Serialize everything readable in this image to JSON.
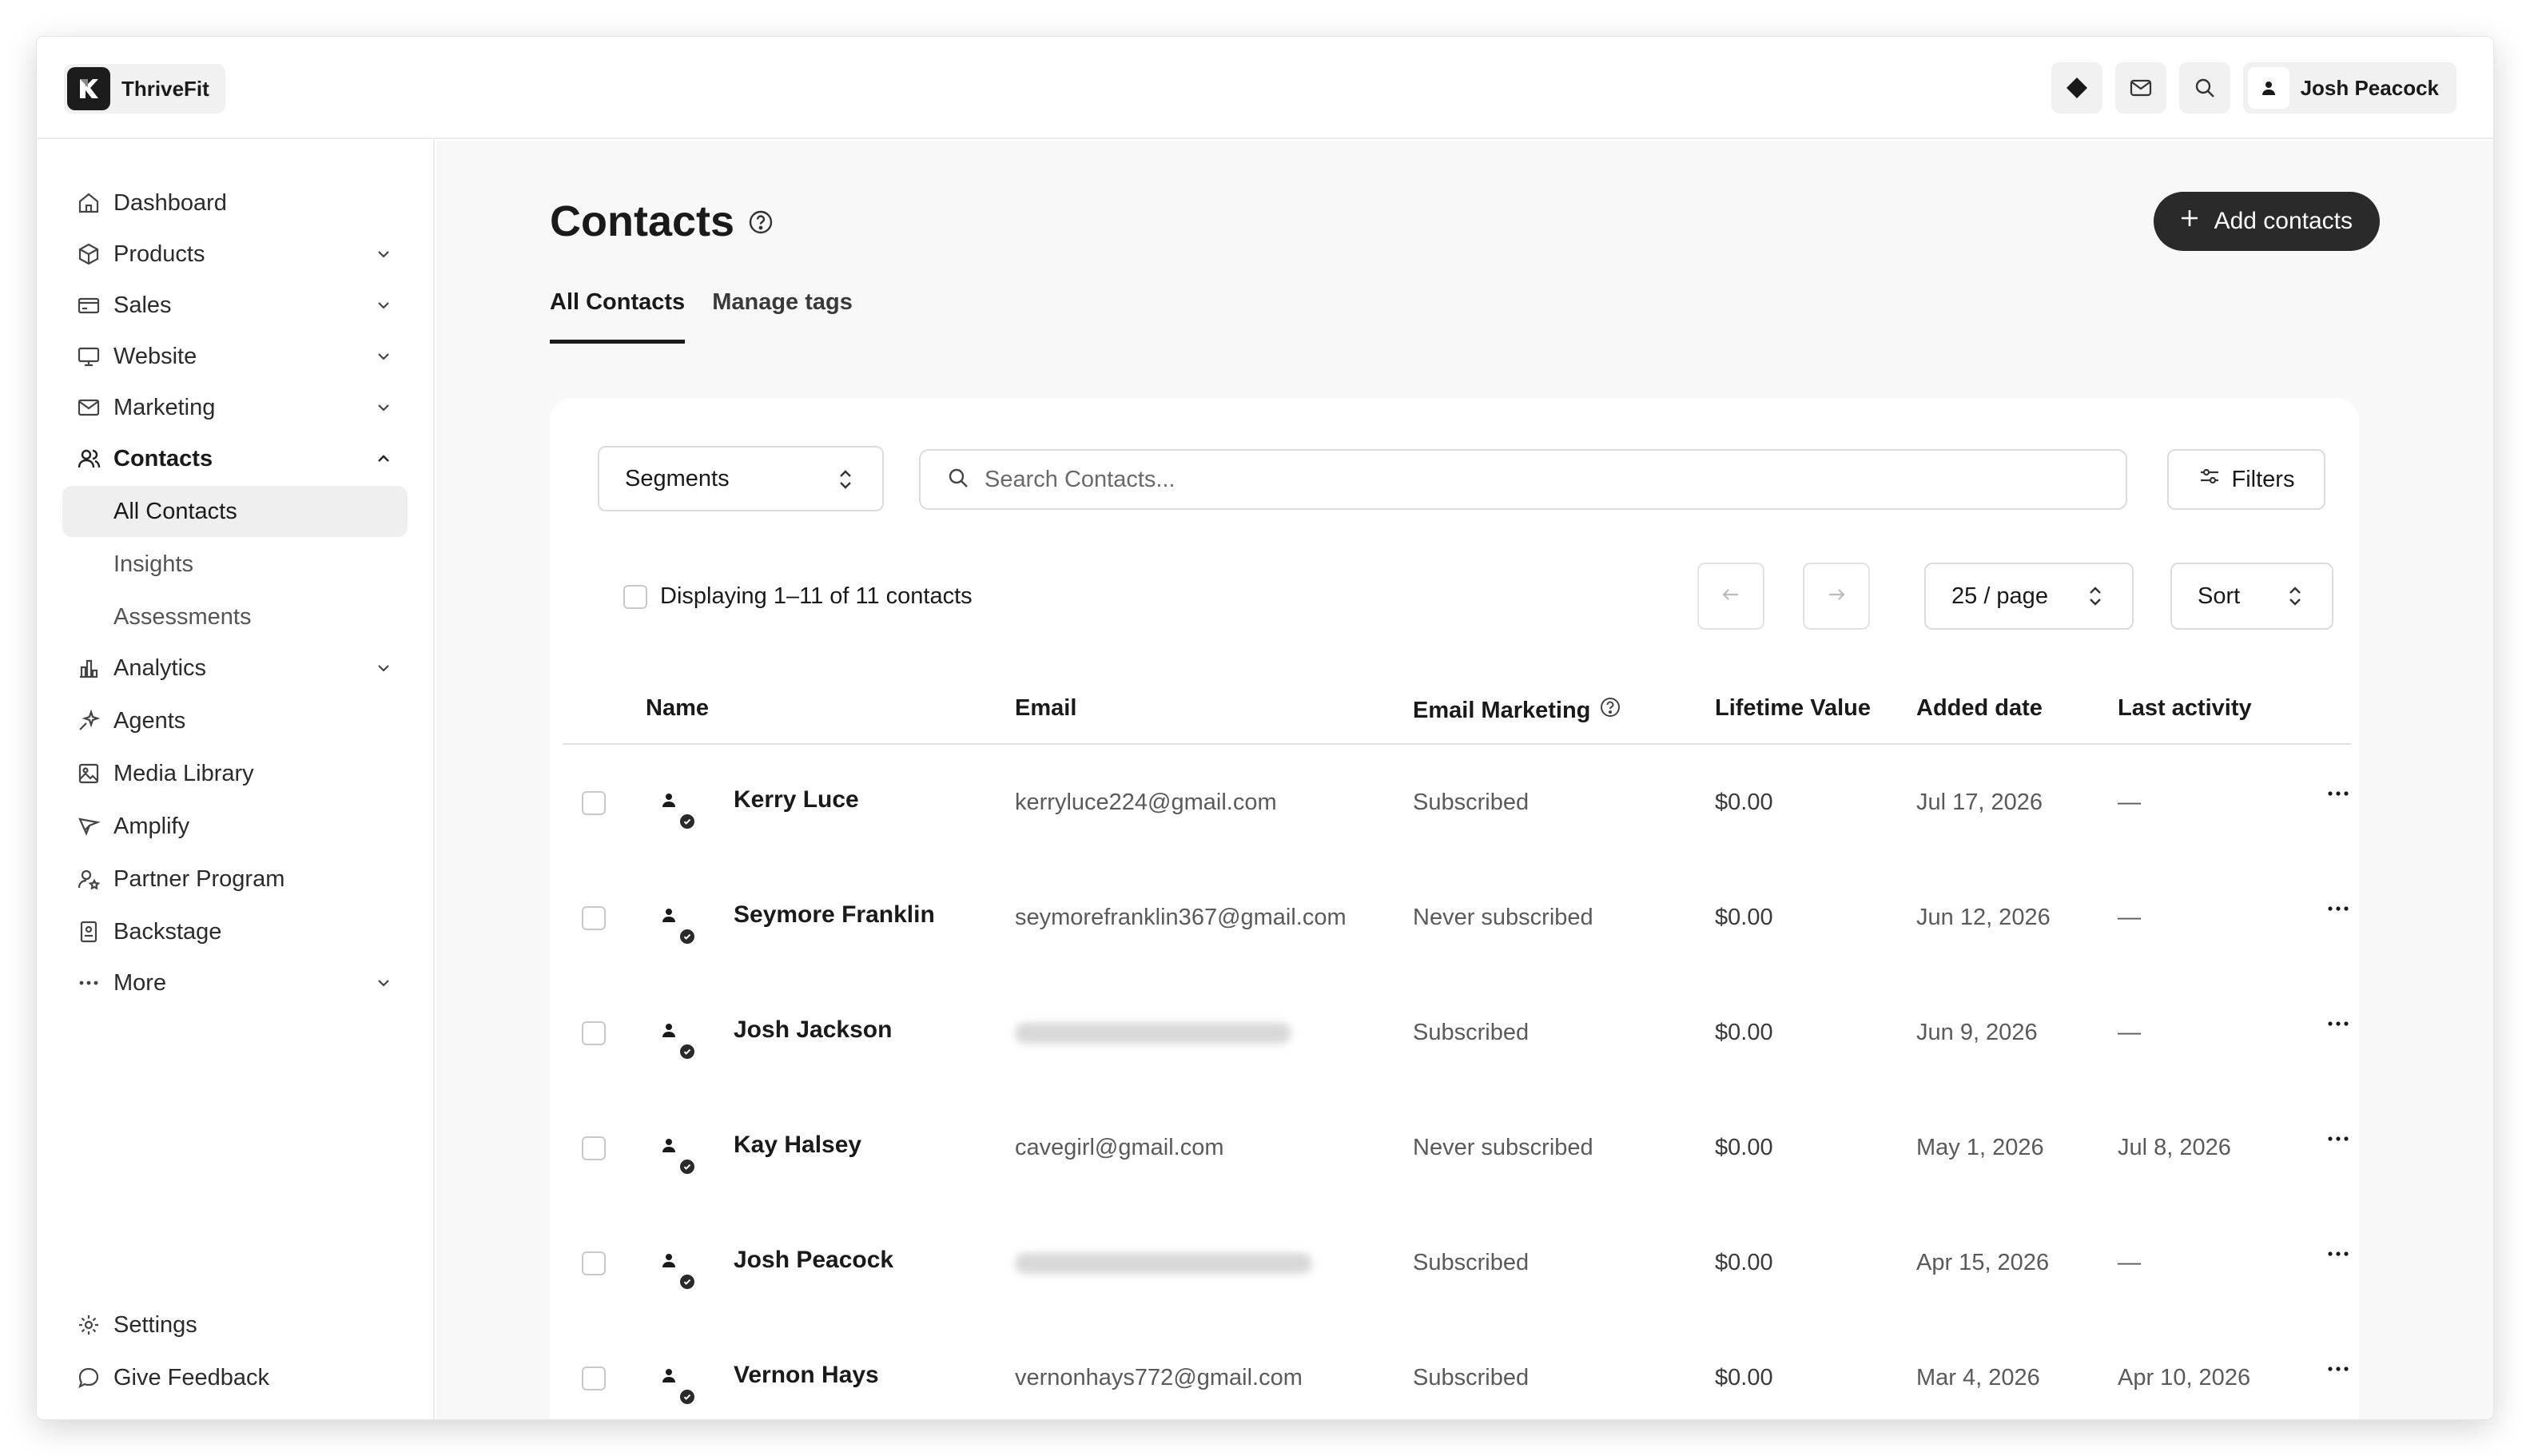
{
  "app": {
    "brand": "ThriveFit"
  },
  "topbar": {
    "user_name": "Josh Peacock",
    "icons": [
      "diamond-icon",
      "mail-icon",
      "search-icon",
      "user-icon"
    ]
  },
  "sidebar": {
    "items": [
      {
        "label": "Dashboard",
        "icon": "home-icon",
        "chevron": false
      },
      {
        "label": "Products",
        "icon": "box-icon",
        "chevron": true
      },
      {
        "label": "Sales",
        "icon": "credit-card-icon",
        "chevron": true
      },
      {
        "label": "Website",
        "icon": "monitor-icon",
        "chevron": true
      },
      {
        "label": "Marketing",
        "icon": "mail-icon",
        "chevron": true
      },
      {
        "label": "Contacts",
        "icon": "users-icon",
        "chevron": true,
        "expanded": true
      }
    ],
    "contacts_sub": [
      "All Contacts",
      "Insights",
      "Assessments"
    ],
    "items_after": [
      {
        "label": "Analytics",
        "icon": "bar-chart-icon",
        "chevron": true
      },
      {
        "label": "Agents",
        "icon": "sparkle-icon",
        "chevron": false
      },
      {
        "label": "Media Library",
        "icon": "image-icon",
        "chevron": false
      },
      {
        "label": "Amplify",
        "icon": "send-icon",
        "chevron": false
      },
      {
        "label": "Partner Program",
        "icon": "user-star-icon",
        "chevron": false
      },
      {
        "label": "Backstage",
        "icon": "badge-icon",
        "chevron": false
      },
      {
        "label": "More",
        "icon": "dots-icon",
        "chevron": true
      }
    ],
    "footer": [
      "Settings",
      "Give Feedback"
    ]
  },
  "main": {
    "title": "Contacts",
    "add_button": "Add contacts",
    "tabs": [
      "All Contacts",
      "Manage tags"
    ],
    "segments": "Segments",
    "search_placeholder": "Search Contacts...",
    "filters": "Filters",
    "display_text": "Displaying 1–11 of 11 contacts",
    "per_page": "25 / page",
    "sort": "Sort",
    "columns": [
      "Name",
      "Email",
      "Email Marketing",
      "Lifetime Value",
      "Added date",
      "Last activity"
    ],
    "rows": [
      {
        "name": "Kerry Luce",
        "email": "kerryluce224@gmail.com",
        "marketing": "Subscribed",
        "value": "$0.00",
        "added": "Jul 17, 2026",
        "last": "—"
      },
      {
        "name": "Seymore Franklin",
        "email": "seymorefranklin367@gmail.com",
        "marketing": "Never subscribed",
        "value": "$0.00",
        "added": "Jun 12, 2026",
        "last": "—"
      },
      {
        "name": "Josh Jackson",
        "email": "",
        "marketing": "Subscribed",
        "value": "$0.00",
        "added": "Jun 9, 2026",
        "last": "—"
      },
      {
        "name": "Kay Halsey",
        "email": "cavegirl@gmail.com",
        "marketing": "Never subscribed",
        "value": "$0.00",
        "added": "May 1, 2026",
        "last": "Jul 8, 2026"
      },
      {
        "name": "Josh Peacock",
        "email": "",
        "marketing": "Subscribed",
        "value": "$0.00",
        "added": "Apr 15, 2026",
        "last": "—"
      },
      {
        "name": "Vernon Hays",
        "email": "vernonhays772@gmail.com",
        "marketing": "Subscribed",
        "value": "$0.00",
        "added": "Mar 4, 2026",
        "last": "Apr 10, 2026"
      }
    ]
  },
  "colors": {
    "accent": "#2a2a2a",
    "active_bg": "#efefef",
    "main_bg": "#f8f8f8"
  }
}
